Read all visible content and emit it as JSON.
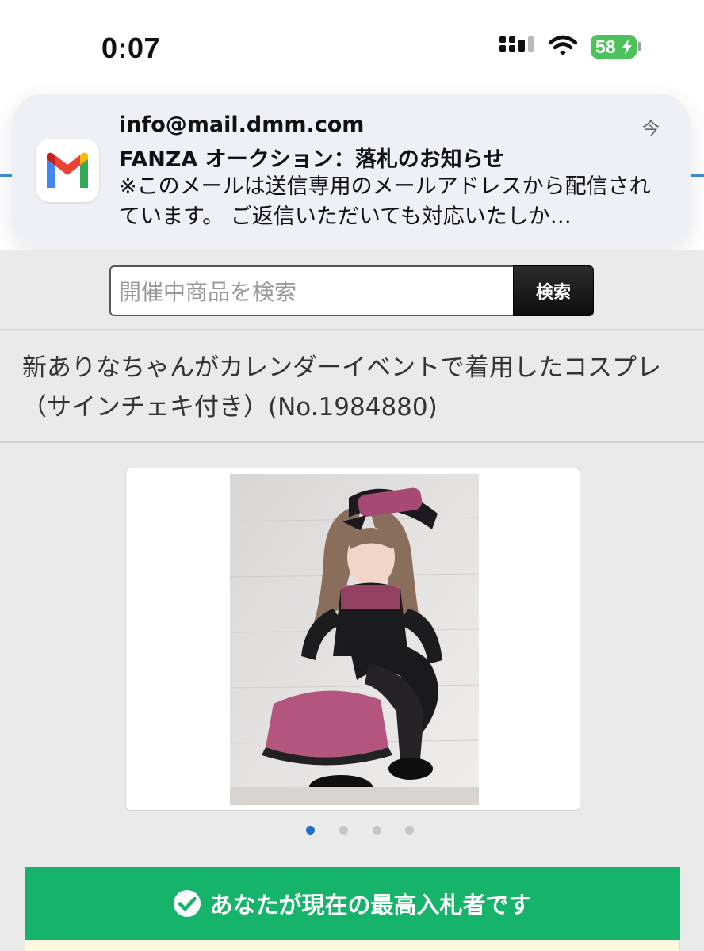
{
  "status_bar": {
    "time": "0:07",
    "battery_level": "58",
    "battery_color": "#4cc35a"
  },
  "notification": {
    "app_icon": "gmail-icon",
    "sender": "info@mail.dmm.com",
    "time": "今",
    "subject": "FANZA オークション：落札のお知らせ",
    "body": "※このメールは送信専用のメールアドレスから配信されています。 ご返信いただいても対応いたしか…"
  },
  "search": {
    "placeholder": "開催中商品を検索",
    "button_label": "検索"
  },
  "item": {
    "title": "新ありなちゃんがカレンダーイベントで着用したコスプレ（サインチェキ付き）(No.1984880)"
  },
  "gallery": {
    "image_count": 4,
    "active_index": 0,
    "active_dot_color": "#1f6fc5"
  },
  "bid_status": {
    "label": "あなたが現在の最高入札者です",
    "icon": "check-circle-icon",
    "color": "#16b36a"
  }
}
